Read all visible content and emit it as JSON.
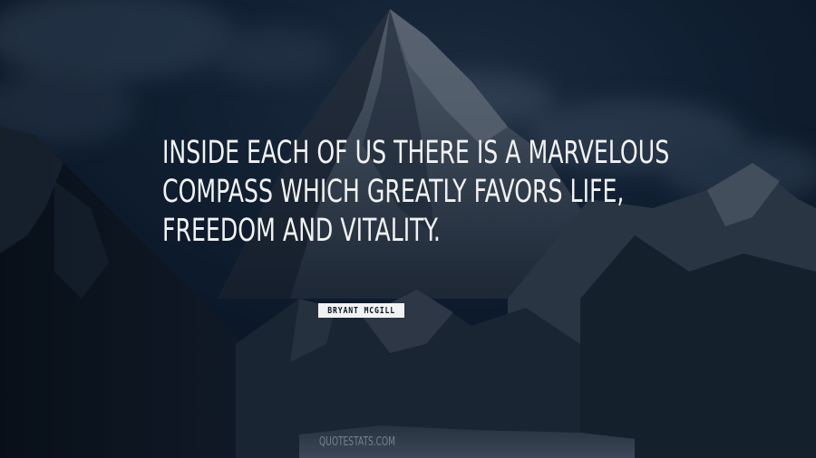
{
  "quote": {
    "lines": [
      "INSIDE EACH OF US THERE IS A MARVELOUS",
      "COMPASS WHICH GREATLY FAVORS LIFE,",
      "FREEDOM AND VITALITY."
    ],
    "text_color": "#f2f2f2"
  },
  "author": {
    "name": "BRYANT MCGILL",
    "badge_color": "#f2f2f2"
  },
  "watermark": {
    "text": "QUOTESTATS.COM"
  },
  "background": {
    "description_colors": {
      "sky": "#0f1f35",
      "snow": "#6b7585",
      "rock": "#0a1019"
    }
  }
}
